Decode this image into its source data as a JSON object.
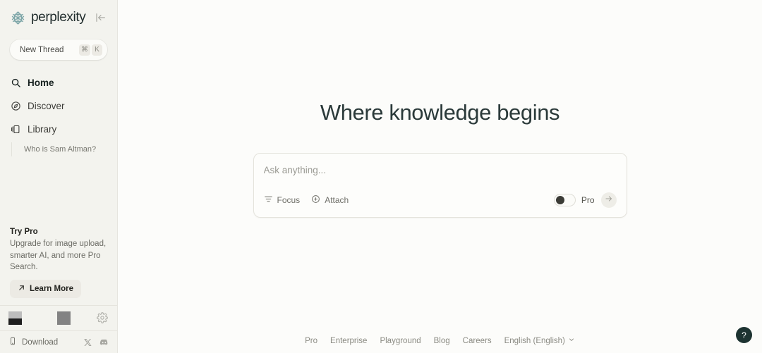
{
  "brand": {
    "name": "perplexity",
    "logo_icon": "perplexity-logo-icon",
    "collapse_icon": "collapse-sidebar-icon"
  },
  "sidebar": {
    "new_thread": {
      "label": "New Thread",
      "shortcut_modifier": "⌘",
      "shortcut_key": "K"
    },
    "nav": [
      {
        "label": "Home",
        "icon": "search-icon",
        "active": true
      },
      {
        "label": "Discover",
        "icon": "compass-icon",
        "active": false
      },
      {
        "label": "Library",
        "icon": "library-icon",
        "active": false
      }
    ],
    "threads": [
      {
        "label": "Who is Sam Altman?"
      }
    ],
    "try_pro": {
      "title": "Try Pro",
      "description": "Upgrade for image upload, smarter AI, and more Pro Search.",
      "cta": "Learn More",
      "cta_icon": "arrow-up-right-icon"
    },
    "account": {
      "avatar_icon": "avatar-placeholder",
      "second_avatar_icon": "avatar-placeholder-solid",
      "settings_icon": "gear-icon"
    },
    "bottom": {
      "download_label": "Download",
      "download_icon": "phone-icon",
      "x_icon": "x-twitter-icon",
      "discord_icon": "discord-icon"
    }
  },
  "main": {
    "headline": "Where knowledge begins",
    "composer": {
      "placeholder": "Ask anything...",
      "value": "",
      "focus_label": "Focus",
      "focus_icon": "sliders-icon",
      "attach_label": "Attach",
      "attach_icon": "plus-circle-icon",
      "pro_label": "Pro",
      "pro_enabled": false,
      "send_icon": "arrow-right-icon"
    }
  },
  "footer": {
    "links": [
      "Pro",
      "Enterprise",
      "Playground",
      "Blog",
      "Careers"
    ],
    "language": "English (English)",
    "language_caret_icon": "chevron-down-icon",
    "help_label": "?"
  },
  "colors": {
    "sidebar_bg": "#f3f3ee",
    "main_bg": "#fcfcfa",
    "headline": "#2b3a3a",
    "accent_teal": "#20808d",
    "help_fab_bg": "#1d3331"
  }
}
